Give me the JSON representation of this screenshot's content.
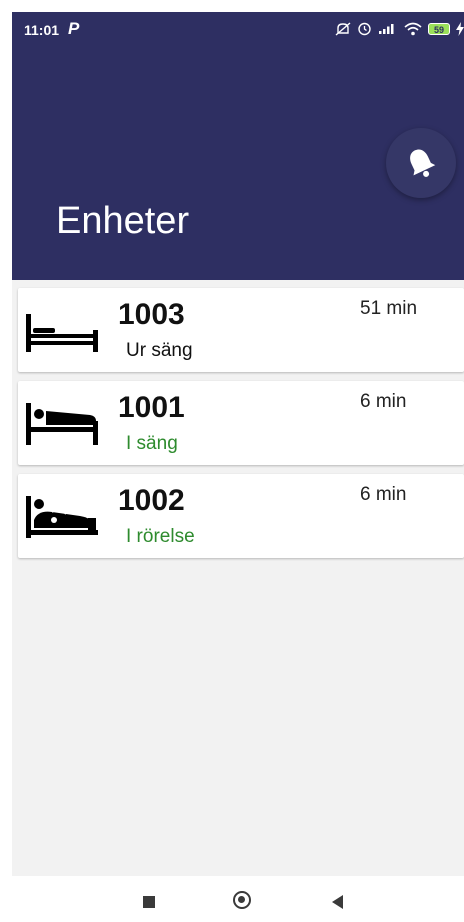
{
  "status_bar": {
    "time": "11:01",
    "app_icon": "P",
    "battery": "59"
  },
  "header": {
    "title": "Enheter",
    "notification_icon": "bell-icon"
  },
  "colors": {
    "header_bg": "#2e2f62",
    "status_green": "#2e8b2e",
    "status_dark": "#111111"
  },
  "units": [
    {
      "id": "1003",
      "status": "Ur säng",
      "time": "51 min",
      "icon": "bed-empty-icon"
    },
    {
      "id": "1001",
      "status": "I säng",
      "time": "6 min",
      "icon": "bed-occupied-icon"
    },
    {
      "id": "1002",
      "status": "I rörelse",
      "time": "6 min",
      "icon": "bed-moving-icon"
    }
  ]
}
